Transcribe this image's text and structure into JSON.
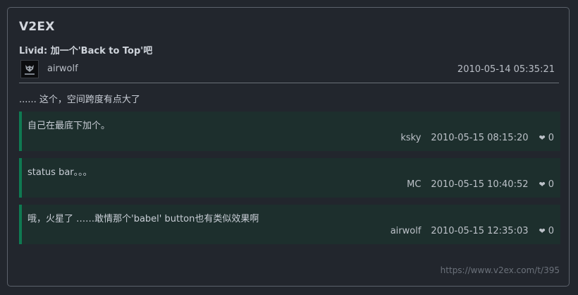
{
  "site": {
    "name": "V2EX"
  },
  "topic": {
    "title": "Livid: 加一个'Back to Top'吧",
    "author": "airwolf",
    "time": "2010-05-14 05:35:21",
    "content": "...... 这个，空间跨度有点大了"
  },
  "replies": [
    {
      "text": "自己在最底下加个。",
      "user": "ksky",
      "time": "2010-05-15 08:15:20",
      "likes": "0"
    },
    {
      "text": "status bar。。。",
      "user": "MC",
      "time": "2010-05-15 10:40:52",
      "likes": "0"
    },
    {
      "text": "哦，火星了 ……敢情那个'babel' button也有类似效果啊",
      "user": "airwolf",
      "time": "2010-05-15 12:35:03",
      "likes": "0"
    }
  ],
  "footer": {
    "link": "https://www.v2ex.com/t/395"
  },
  "icons": {
    "heart": "heart-icon",
    "avatar": "avatar"
  },
  "colors": {
    "background": "#22262d",
    "reply_background": "#1d2f2d",
    "reply_accent": "#0f7a52",
    "border": "#5c626b"
  }
}
